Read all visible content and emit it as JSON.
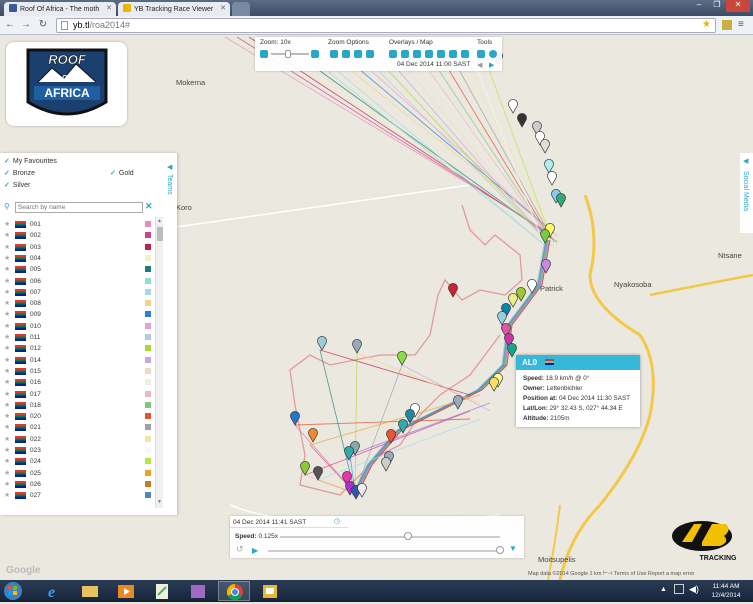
{
  "browser": {
    "tabs": [
      {
        "title": "Roof Of Africa - The moth"
      },
      {
        "title": "YB Tracking Race Viewer"
      }
    ],
    "url_host": "yb.tl",
    "url_path": "/roa2014#"
  },
  "places": {
    "mokerna": "Mokerna",
    "koro": "Koro",
    "ntsane": "Ntsane",
    "nyakosoba": "Nyakosoba",
    "patrick": "Patrick",
    "moitsupelis": "Moitsupelis"
  },
  "logo": {
    "line1": "ROOF",
    "line2": "OF",
    "line3": "AFRICA"
  },
  "categories": {
    "favourites": "My Favourites",
    "bronze": "Bronze",
    "gold": "Gold",
    "silver": "Silver"
  },
  "teams_label": "Teams",
  "social_label": "Social Media",
  "search": {
    "placeholder": "Search by name"
  },
  "entries": [
    {
      "num": "001",
      "color": "#e58fc1"
    },
    {
      "num": "002",
      "color": "#d43f8d"
    },
    {
      "num": "003",
      "color": "#c2224a"
    },
    {
      "num": "004",
      "color": "#f2f0c4"
    },
    {
      "num": "005",
      "color": "#14827a"
    },
    {
      "num": "006",
      "color": "#8fe0d0"
    },
    {
      "num": "007",
      "color": "#a8d8e8"
    },
    {
      "num": "008",
      "color": "#f5d28a"
    },
    {
      "num": "009",
      "color": "#2b7fd4"
    },
    {
      "num": "010",
      "color": "#e8a0d8"
    },
    {
      "num": "011",
      "color": "#b8c8e0"
    },
    {
      "num": "012",
      "color": "#a8d834"
    },
    {
      "num": "014",
      "color": "#c8a8e0"
    },
    {
      "num": "015",
      "color": "#f2d8c8"
    },
    {
      "num": "016",
      "color": "#f0f0e0"
    },
    {
      "num": "017",
      "color": "#e8b8c8"
    },
    {
      "num": "018",
      "color": "#88c088"
    },
    {
      "num": "020",
      "color": "#e85030"
    },
    {
      "num": "021",
      "color": "#a0a0a0"
    },
    {
      "num": "022",
      "color": "#f0e8a0"
    },
    {
      "num": "023",
      "color": "#f8f8f8"
    },
    {
      "num": "024",
      "color": "#b8e840"
    },
    {
      "num": "025",
      "color": "#f0a020"
    },
    {
      "num": "026",
      "color": "#c87828"
    },
    {
      "num": "027",
      "color": "#4a8ab8"
    }
  ],
  "toolbar": {
    "zoom_label": "Zoom: 10x",
    "zoom_options_label": "Zoom Options",
    "overlays_label": "Overlays / Map",
    "tools_label": "Tools",
    "datetime": "04 Dec 2014 11:00 SAST"
  },
  "popup": {
    "name": "AL0",
    "speed_label": "Speed:",
    "speed": "18.9 km/h @ 0°",
    "owner_label": "Owner:",
    "owner": "Lettenbichler",
    "position_label": "Position at:",
    "position": "04 Dec 2014 11:30 SAST",
    "latlon_label": "Lat/Lon:",
    "latlon": "29° 32.43 S, 027° 44.34 E",
    "altitude_label": "Altitude:",
    "altitude": "2105m"
  },
  "playback": {
    "time": "04 Dec 2014 11:41 SAST",
    "speed_label": "Speed:",
    "speed": "0.125x"
  },
  "yb_logo": "TRACKING",
  "attribution": "Map data ©2014 Google   1 km ⊢⊣   Terms of Use   Report a map error",
  "google": "Google",
  "clock": {
    "time": "11:44 AM",
    "date": "12/4/2014"
  }
}
